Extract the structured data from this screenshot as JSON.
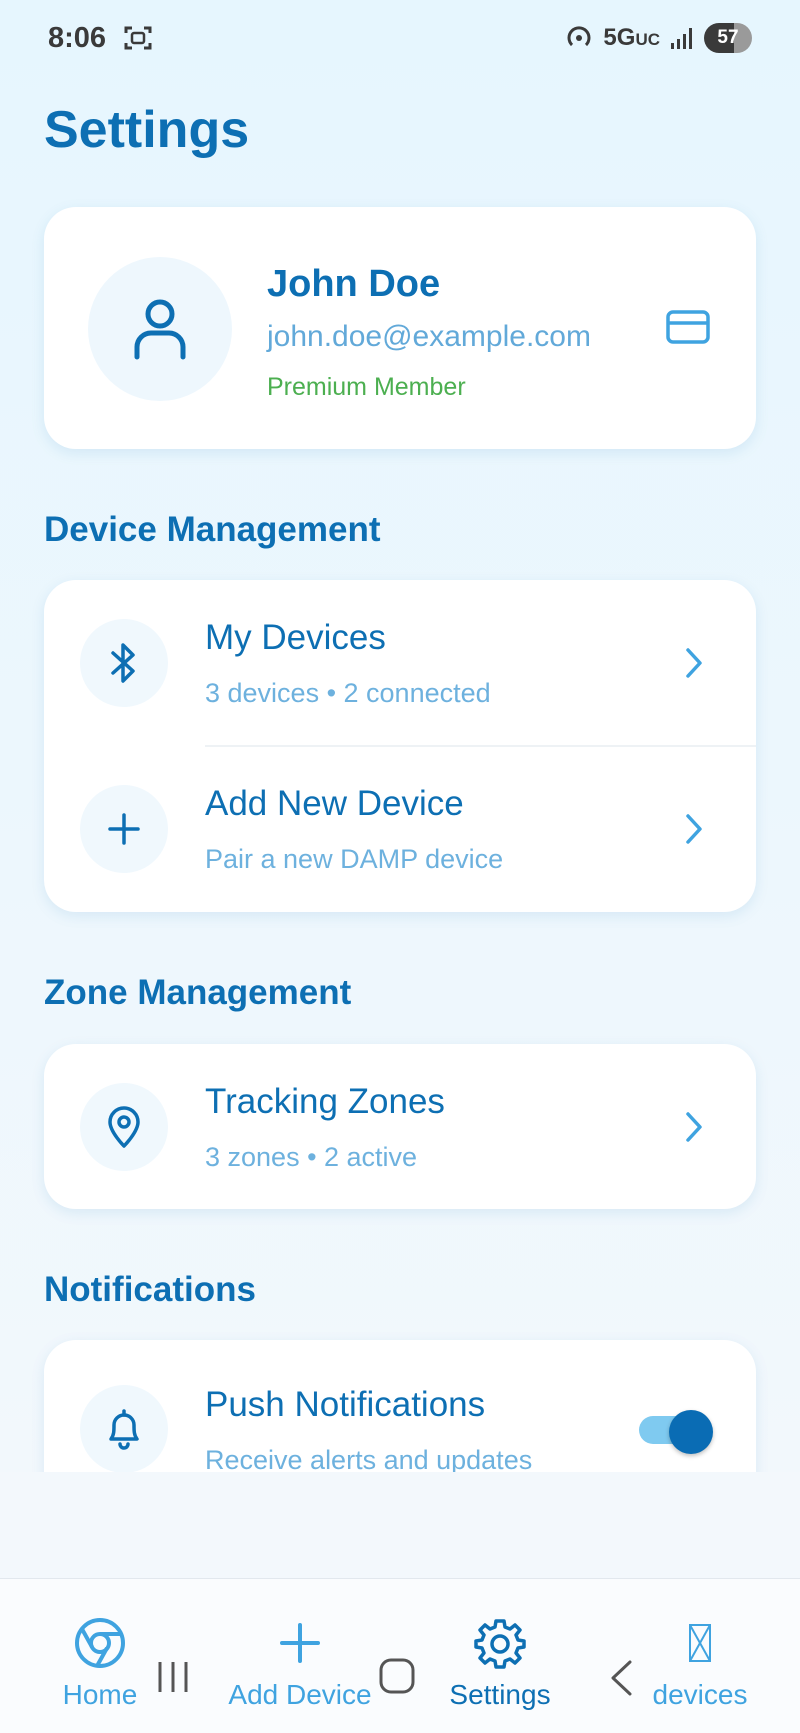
{
  "status_bar": {
    "time": "8:06",
    "network": "5G",
    "network_suffix": "UC",
    "battery": "57"
  },
  "page": {
    "title": "Settings"
  },
  "profile": {
    "name": "John Doe",
    "email": "john.doe@example.com",
    "tier": "Premium Member"
  },
  "sections": {
    "device_management": "Device Management",
    "zone_management": "Zone Management",
    "notifications": "Notifications"
  },
  "device_rows": [
    {
      "title": "My Devices",
      "subtitle": "3 devices • 2 connected",
      "icon": "bluetooth-icon"
    },
    {
      "title": "Add New Device",
      "subtitle": "Pair a new DAMP device",
      "icon": "plus-icon"
    }
  ],
  "zone_rows": [
    {
      "title": "Tracking Zones",
      "subtitle": "3 zones • 2 active",
      "icon": "location-pin-icon"
    }
  ],
  "notification_rows": [
    {
      "title": "Push Notifications",
      "subtitle": "Receive alerts and updates",
      "icon": "bell-icon",
      "enabled": true
    }
  ],
  "bottom_nav": [
    {
      "label": "Home",
      "icon": "chrome-icon",
      "active": false
    },
    {
      "label": "Add Device",
      "icon": "plus-icon",
      "active": false
    },
    {
      "label": "Settings",
      "icon": "gear-icon",
      "active": true
    },
    {
      "label": "devices",
      "icon": "broken-image-icon",
      "active": false
    }
  ],
  "colors": {
    "primary": "#0d6fb3",
    "secondary_text": "#62a9d9",
    "premium": "#4caf50",
    "nav_inactive": "#3fa3e0"
  }
}
